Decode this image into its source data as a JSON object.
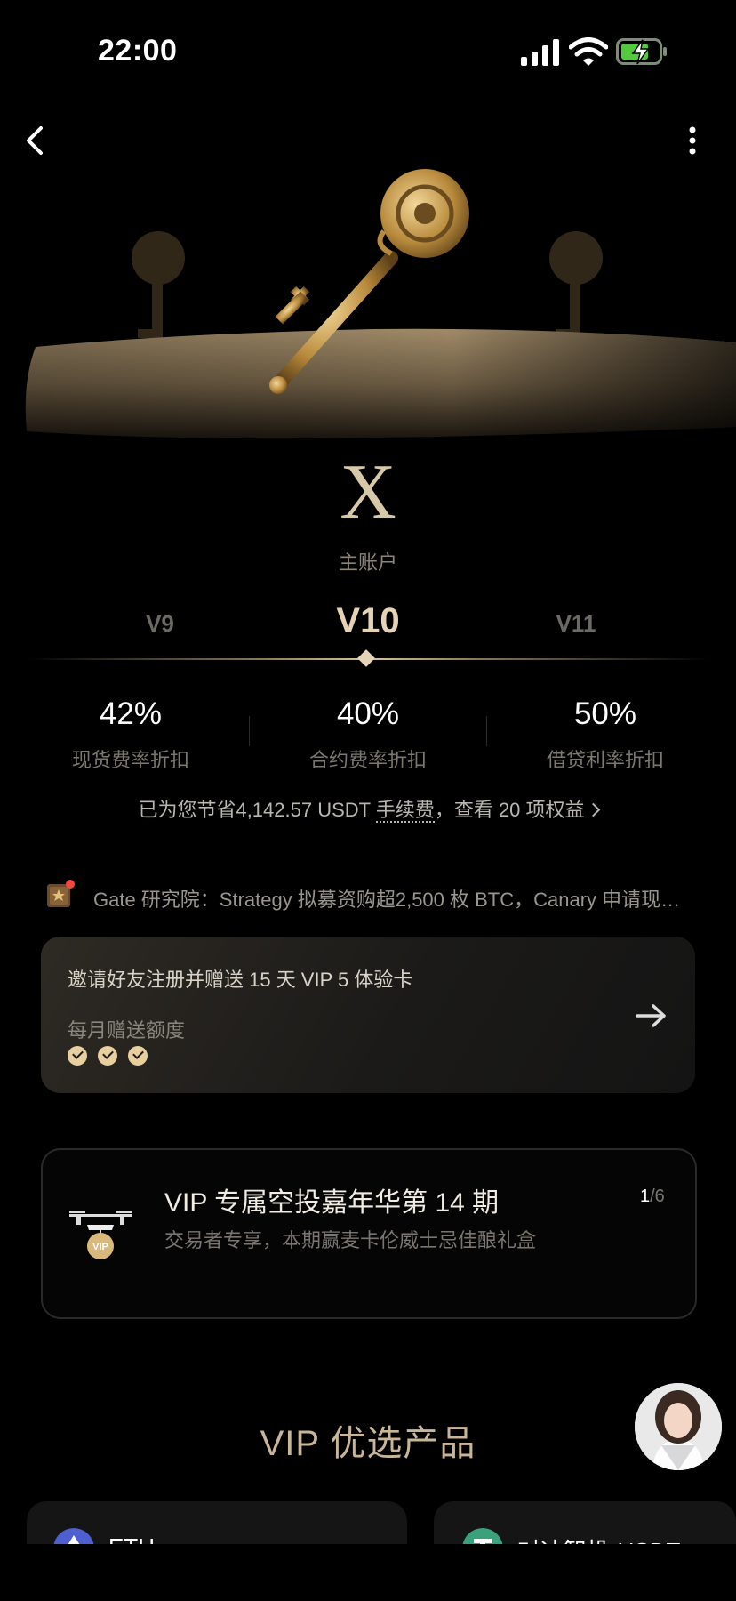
{
  "status_bar": {
    "time": "22:00"
  },
  "hero": {
    "emblem_letter": "X",
    "account_label": "主账户"
  },
  "levels": {
    "prev": "V9",
    "current": "V10",
    "next": "V11"
  },
  "stats": [
    {
      "value": "42%",
      "label": "现货费率折扣"
    },
    {
      "value": "40%",
      "label": "合约费率折扣"
    },
    {
      "value": "50%",
      "label": "借贷利率折扣"
    }
  ],
  "savings": {
    "prefix": "已为您节省4,142.57 USDT ",
    "fee_term": "手续费",
    "suffix": "，查看 20 项权益"
  },
  "news": {
    "text": "Gate 研究院：Strategy 拟募资购超2,500 枚 BTC，Canary 申请现…"
  },
  "invite_card": {
    "title": "邀请好友注册并赠送 15 天 VIP 5 体验卡",
    "subtitle": "每月赠送额度",
    "quota_checked": 3
  },
  "airdrop_card": {
    "title": "VIP 专属空投嘉年华第 14 期",
    "subtitle": "交易者专享，本期赢麦卡伦威士忌佳酿礼盒",
    "page_current": "1",
    "page_total": "/6",
    "badge": "VIP"
  },
  "vip_products": {
    "title": "VIP 优选产品",
    "items": [
      {
        "name": "ETH",
        "icon": "eth-icon",
        "color": "#4d5fd1"
      },
      {
        "name": "对冲智投-USDT",
        "icon": "usdt-icon",
        "color": "#3aa27a"
      }
    ]
  },
  "colors": {
    "gold": "#e6d3b5",
    "card_border": "#2a2a2a",
    "background": "#000000"
  }
}
